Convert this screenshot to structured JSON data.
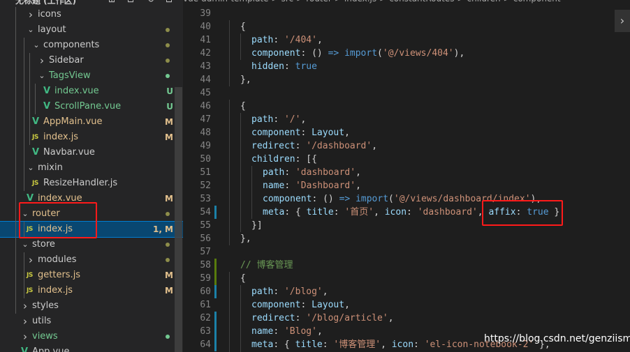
{
  "explorer": {
    "workspace_title": "无标题 (工作区)",
    "tree": [
      {
        "label": "icons",
        "type": "folder",
        "chevron": "right",
        "color": "#cccccc",
        "badge": "",
        "dot": ""
      },
      {
        "label": "layout",
        "type": "folder",
        "chevron": "down",
        "color": "#cccccc",
        "badge": "",
        "dot": "#8d8d4a"
      },
      {
        "label": "components",
        "type": "folder",
        "chevron": "down",
        "color": "#cccccc",
        "badge": "",
        "dot": "#8d8d4a"
      },
      {
        "label": "Sidebar",
        "type": "folder",
        "chevron": "right",
        "color": "#cccccc",
        "badge": "",
        "dot": "#8d8d4a"
      },
      {
        "label": "TagsView",
        "type": "folder",
        "chevron": "down",
        "color": "#73c991",
        "badge": "",
        "dot": "#73c991"
      },
      {
        "label": "index.vue",
        "type": "vue",
        "chevron": "",
        "color": "#73c991",
        "badge": "U",
        "badge_color": "#73c991"
      },
      {
        "label": "ScrollPane.vue",
        "type": "vue",
        "chevron": "",
        "color": "#73c991",
        "badge": "U",
        "badge_color": "#73c991"
      },
      {
        "label": "AppMain.vue",
        "type": "vue",
        "chevron": "",
        "color": "#e2c08d",
        "badge": "M",
        "badge_color": "#e2c08d"
      },
      {
        "label": "index.js",
        "type": "js",
        "chevron": "",
        "color": "#e2c08d",
        "badge": "M",
        "badge_color": "#e2c08d"
      },
      {
        "label": "Navbar.vue",
        "type": "vue",
        "chevron": "",
        "color": "#cccccc",
        "badge": "",
        "dot": ""
      },
      {
        "label": "mixin",
        "type": "folder",
        "chevron": "down",
        "color": "#cccccc",
        "badge": "",
        "dot": ""
      },
      {
        "label": "ResizeHandler.js",
        "type": "js",
        "chevron": "",
        "color": "#cccccc",
        "badge": "",
        "dot": ""
      },
      {
        "label": "index.vue",
        "type": "vue",
        "chevron": "",
        "color": "#e2c08d",
        "badge": "M",
        "badge_color": "#e2c08d"
      },
      {
        "label": "router",
        "type": "folder",
        "chevron": "down",
        "color": "#e2c08d",
        "badge": "",
        "dot": "#8d8d4a"
      },
      {
        "label": "index.js",
        "type": "js",
        "chevron": "",
        "color": "#e2c08d",
        "badge": "1, M",
        "badge_color": "#e2c08d",
        "selected": true
      },
      {
        "label": "store",
        "type": "folder",
        "chevron": "down",
        "color": "#cccccc",
        "badge": "",
        "dot": "#8d8d4a"
      },
      {
        "label": "modules",
        "type": "folder",
        "chevron": "right",
        "color": "#cccccc",
        "badge": "",
        "dot": "#8d8d4a"
      },
      {
        "label": "getters.js",
        "type": "js",
        "chevron": "",
        "color": "#e2c08d",
        "badge": "M",
        "badge_color": "#e2c08d"
      },
      {
        "label": "index.js",
        "type": "js",
        "chevron": "",
        "color": "#e2c08d",
        "badge": "M",
        "badge_color": "#e2c08d"
      },
      {
        "label": "styles",
        "type": "folder",
        "chevron": "right",
        "color": "#cccccc",
        "badge": "",
        "dot": ""
      },
      {
        "label": "utils",
        "type": "folder",
        "chevron": "right",
        "color": "#cccccc",
        "badge": "",
        "dot": ""
      },
      {
        "label": "views",
        "type": "folder",
        "chevron": "right",
        "color": "#73c991",
        "badge": "",
        "dot": "#73c991"
      },
      {
        "label": "App.vue",
        "type": "vue",
        "chevron": "",
        "color": "#cccccc",
        "badge": "",
        "dot": ""
      }
    ]
  },
  "breadcrumb": [
    "vue-admin-template",
    ">",
    "src",
    ">",
    "router",
    ">",
    "index.js",
    ">",
    "constantRoutes",
    ">",
    "children",
    ">",
    "component"
  ],
  "code": [
    {
      "n": "39",
      "indent": 0,
      "tokens": []
    },
    {
      "n": "40",
      "indent": 1,
      "tokens": [
        [
          "p",
          "{"
        ]
      ]
    },
    {
      "n": "41",
      "indent": 2,
      "tokens": [
        [
          "k",
          "path"
        ],
        [
          "p",
          ": "
        ],
        [
          "s",
          "'/404'"
        ],
        [
          "p",
          ","
        ]
      ]
    },
    {
      "n": "42",
      "indent": 2,
      "tokens": [
        [
          "k",
          "component"
        ],
        [
          "p",
          ": () "
        ],
        [
          "b",
          "=>"
        ],
        [
          "p",
          " "
        ],
        [
          "b",
          "import"
        ],
        [
          "p",
          "("
        ],
        [
          "s",
          "'@/views/404'"
        ],
        [
          "p",
          "),"
        ]
      ]
    },
    {
      "n": "43",
      "indent": 2,
      "tokens": [
        [
          "k",
          "hidden"
        ],
        [
          "p",
          ": "
        ],
        [
          "b",
          "true"
        ]
      ]
    },
    {
      "n": "44",
      "indent": 1,
      "tokens": [
        [
          "p",
          "},"
        ]
      ]
    },
    {
      "n": "45",
      "indent": 0,
      "tokens": []
    },
    {
      "n": "46",
      "indent": 1,
      "tokens": [
        [
          "p",
          "{"
        ]
      ]
    },
    {
      "n": "47",
      "indent": 2,
      "tokens": [
        [
          "k",
          "path"
        ],
        [
          "p",
          ": "
        ],
        [
          "s",
          "'/'"
        ],
        [
          "p",
          ","
        ]
      ]
    },
    {
      "n": "48",
      "indent": 2,
      "tokens": [
        [
          "k",
          "component"
        ],
        [
          "p",
          ": "
        ],
        [
          "k",
          "Layout"
        ],
        [
          "p",
          ","
        ]
      ]
    },
    {
      "n": "49",
      "indent": 2,
      "tokens": [
        [
          "k",
          "redirect"
        ],
        [
          "p",
          ": "
        ],
        [
          "s",
          "'/dashboard'"
        ],
        [
          "p",
          ","
        ]
      ]
    },
    {
      "n": "50",
      "indent": 2,
      "tokens": [
        [
          "k",
          "children"
        ],
        [
          "p",
          ": ["
        ],
        [
          "p",
          "{"
        ]
      ]
    },
    {
      "n": "51",
      "indent": 3,
      "tokens": [
        [
          "k",
          "path"
        ],
        [
          "p",
          ": "
        ],
        [
          "s",
          "'dashboard'"
        ],
        [
          "p",
          ","
        ]
      ]
    },
    {
      "n": "52",
      "indent": 3,
      "tokens": [
        [
          "k",
          "name"
        ],
        [
          "p",
          ": "
        ],
        [
          "s",
          "'Dashboard'"
        ],
        [
          "p",
          ","
        ]
      ]
    },
    {
      "n": "53",
      "indent": 3,
      "tokens": [
        [
          "k",
          "component"
        ],
        [
          "p",
          ": () "
        ],
        [
          "b",
          "=>"
        ],
        [
          "p",
          " "
        ],
        [
          "b",
          "import"
        ],
        [
          "p",
          "("
        ],
        [
          "s",
          "'@/views/dashboard/index'"
        ],
        [
          "p",
          "),"
        ]
      ]
    },
    {
      "n": "54",
      "indent": 3,
      "tokens": [
        [
          "k",
          "meta"
        ],
        [
          "p",
          ": { "
        ],
        [
          "k",
          "title"
        ],
        [
          "p",
          ": "
        ],
        [
          "s",
          "'首页'"
        ],
        [
          "p",
          ", "
        ],
        [
          "k",
          "icon"
        ],
        [
          "p",
          ": "
        ],
        [
          "s",
          "'dashboard'"
        ],
        [
          "p",
          ", "
        ],
        [
          "k",
          "affix"
        ],
        [
          "p",
          ": "
        ],
        [
          "b",
          "true"
        ],
        [
          "p",
          " }"
        ]
      ]
    },
    {
      "n": "55",
      "indent": 2,
      "tokens": [
        [
          "p",
          "}]"
        ]
      ]
    },
    {
      "n": "56",
      "indent": 1,
      "tokens": [
        [
          "p",
          "},"
        ]
      ]
    },
    {
      "n": "57",
      "indent": 0,
      "tokens": []
    },
    {
      "n": "58",
      "indent": 1,
      "tokens": [
        [
          "c",
          "// 博客管理"
        ]
      ]
    },
    {
      "n": "59",
      "indent": 1,
      "tokens": [
        [
          "p",
          "{"
        ]
      ]
    },
    {
      "n": "60",
      "indent": 2,
      "tokens": [
        [
          "k",
          "path"
        ],
        [
          "p",
          ": "
        ],
        [
          "s",
          "'/blog'"
        ],
        [
          "p",
          ","
        ]
      ]
    },
    {
      "n": "61",
      "indent": 2,
      "tokens": [
        [
          "k",
          "component"
        ],
        [
          "p",
          ": "
        ],
        [
          "k",
          "Layout"
        ],
        [
          "p",
          ","
        ]
      ]
    },
    {
      "n": "62",
      "indent": 2,
      "tokens": [
        [
          "k",
          "redirect"
        ],
        [
          "p",
          ": "
        ],
        [
          "s",
          "'/blog/article'"
        ],
        [
          "p",
          ","
        ]
      ]
    },
    {
      "n": "63",
      "indent": 2,
      "tokens": [
        [
          "k",
          "name"
        ],
        [
          "p",
          ": "
        ],
        [
          "s",
          "'Blog'"
        ],
        [
          "p",
          ","
        ]
      ]
    },
    {
      "n": "64",
      "indent": 2,
      "tokens": [
        [
          "k",
          "meta"
        ],
        [
          "p",
          ": { "
        ],
        [
          "k",
          "title"
        ],
        [
          "p",
          ": "
        ],
        [
          "s",
          "'博客管理'"
        ],
        [
          "p",
          ", "
        ],
        [
          "k",
          "icon"
        ],
        [
          "p",
          ": "
        ],
        [
          "s",
          "'el-icon-notebook-2'"
        ],
        [
          "p",
          " },"
        ]
      ]
    }
  ],
  "watermark": "https://blog.csdn.net/genziisme",
  "colors": {
    "sidebar_bg": "#252526",
    "editor_bg": "#1e1e1e",
    "selection": "#094771",
    "highlight_box": "#ff1a1a",
    "modified": "#e2c08d",
    "untracked": "#73c991"
  }
}
